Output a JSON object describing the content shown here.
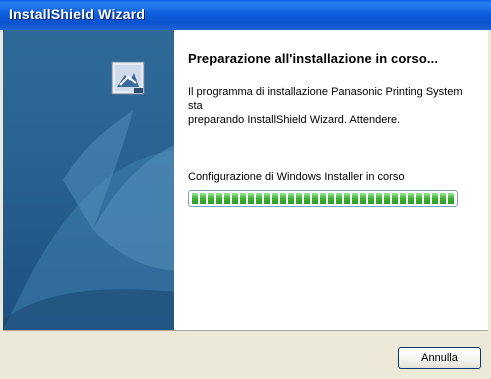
{
  "window": {
    "title": "InstallShield Wizard"
  },
  "main": {
    "heading": "Preparazione all'installazione in corso...",
    "description_line1": "Il programma di installazione Panasonic Printing System sta",
    "description_line2": "preparando InstallShield Wizard.  Attendere.",
    "status_text": "Configurazione di Windows Installer in corso",
    "progress_fraction": 1.0
  },
  "footer": {
    "cancel_label": "Annulla"
  },
  "icons": {
    "installer": "installer-icon"
  },
  "colors": {
    "titlebar": "#0a52cf",
    "side_panel": "#2a6391",
    "progress_fill": "#3ab030",
    "dialog_bg": "#ece9d8"
  }
}
